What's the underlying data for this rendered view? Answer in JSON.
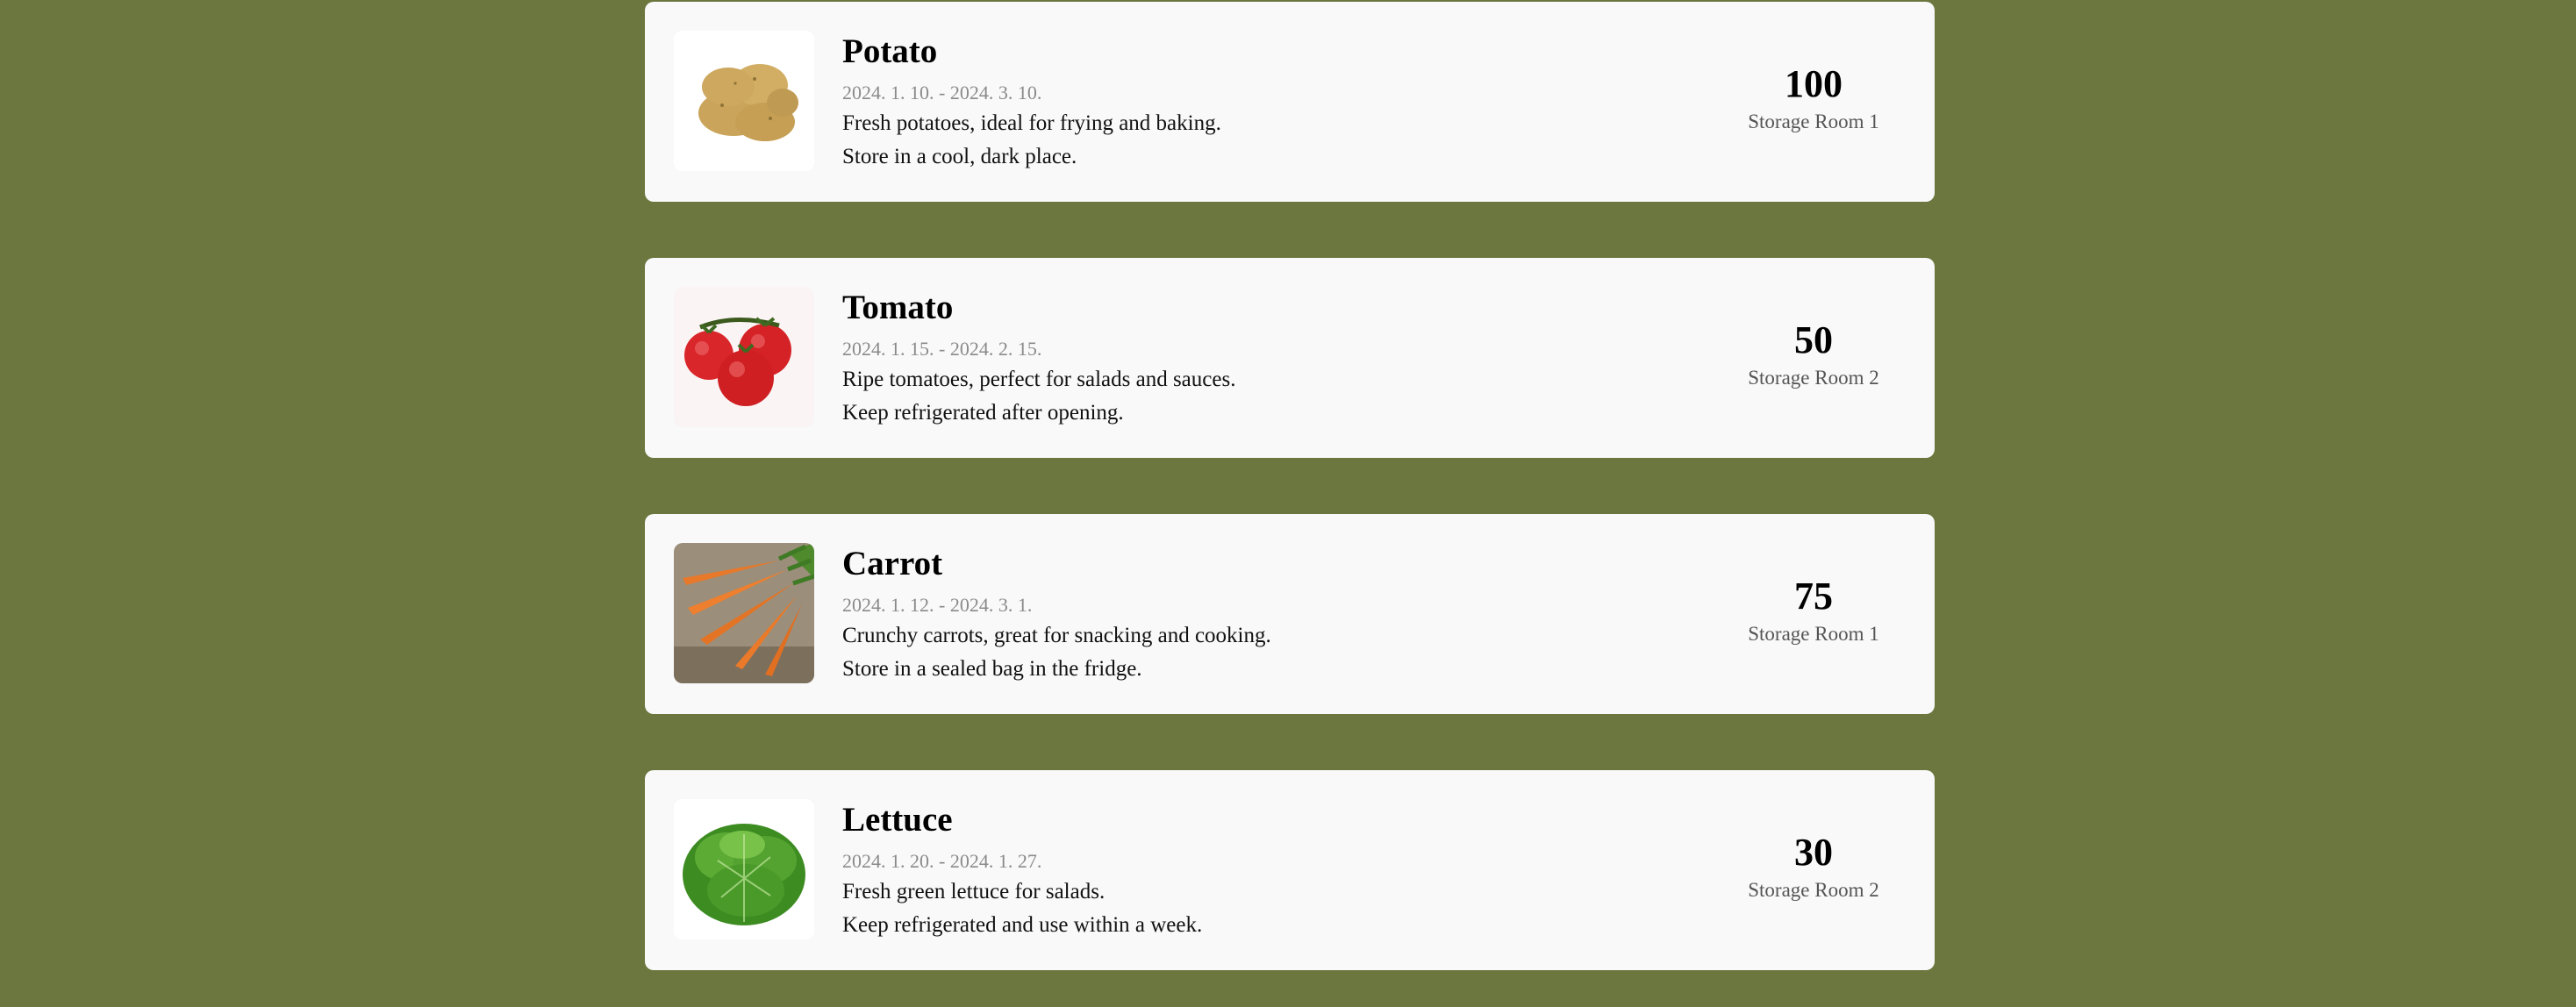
{
  "items": [
    {
      "name": "Potato",
      "dates": "2024. 1. 10. - 2024. 3. 10.",
      "desc1": "Fresh potatoes, ideal for frying and baking.",
      "desc2": "Store in a cool, dark place.",
      "quantity": "100",
      "location": "Storage Room 1",
      "image": "potato-image"
    },
    {
      "name": "Tomato",
      "dates": "2024. 1. 15. - 2024. 2. 15.",
      "desc1": "Ripe tomatoes, perfect for salads and sauces.",
      "desc2": "Keep refrigerated after opening.",
      "quantity": "50",
      "location": "Storage Room 2",
      "image": "tomato-image"
    },
    {
      "name": "Carrot",
      "dates": "2024. 1. 12. - 2024. 3. 1.",
      "desc1": "Crunchy carrots, great for snacking and cooking.",
      "desc2": "Store in a sealed bag in the fridge.",
      "quantity": "75",
      "location": "Storage Room 1",
      "image": "carrot-image"
    },
    {
      "name": "Lettuce",
      "dates": "2024. 1. 20. - 2024. 1. 27.",
      "desc1": "Fresh green lettuce for salads.",
      "desc2": "Keep refrigerated and use within a week.",
      "quantity": "30",
      "location": "Storage Room 2",
      "image": "lettuce-image"
    }
  ],
  "colors": {
    "background": "#6b773e",
    "card": "#f9f9f9"
  }
}
